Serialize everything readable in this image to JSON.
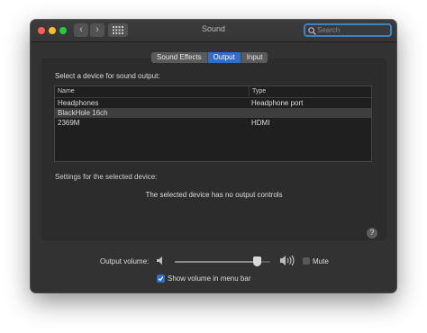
{
  "window": {
    "title": "Sound",
    "search_placeholder": "Search"
  },
  "tabs": [
    {
      "label": "Sound Effects",
      "active": false
    },
    {
      "label": "Output",
      "active": true
    },
    {
      "label": "Input",
      "active": false
    }
  ],
  "output": {
    "select_label": "Select a device for sound output:",
    "columns": [
      "Name",
      "Type"
    ],
    "devices": [
      {
        "name": "Headphones",
        "type": "Headphone port",
        "selected": false
      },
      {
        "name": "BlackHole 16ch",
        "type": "",
        "selected": true
      },
      {
        "name": "2369M",
        "type": "HDMI",
        "selected": false
      }
    ],
    "settings_label": "Settings for the selected device:",
    "no_controls_text": "The selected device has no output controls",
    "help_label": "?"
  },
  "volume": {
    "label": "Output volume:",
    "level": 0.86,
    "mute_label": "Mute",
    "mute_checked": false,
    "show_in_menu_label": "Show volume in menu bar",
    "show_in_menu_checked": true
  },
  "colors": {
    "accent": "#2d6ecf",
    "close": "#fc5f57",
    "minimize": "#fdbc2e",
    "maximize": "#28c840"
  }
}
